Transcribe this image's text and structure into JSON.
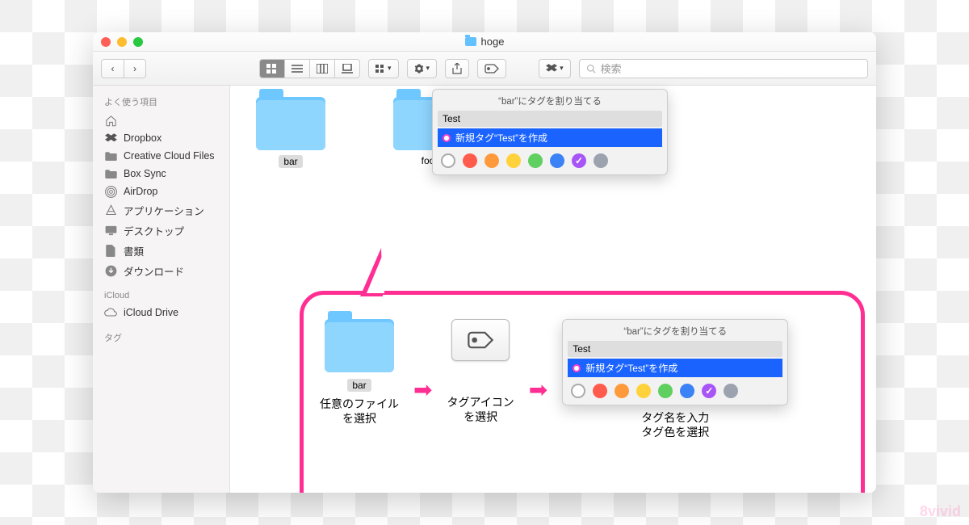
{
  "window": {
    "title": "hoge"
  },
  "toolbar": {
    "search_placeholder": "検索"
  },
  "sidebar": {
    "favorites_header": "よく使う項目",
    "items": [
      {
        "label": "",
        "icon": "home-icon"
      },
      {
        "label": "Dropbox",
        "icon": "dropbox-icon"
      },
      {
        "label": "Creative Cloud Files",
        "icon": "folder-icon"
      },
      {
        "label": "Box Sync",
        "icon": "folder-icon"
      },
      {
        "label": "AirDrop",
        "icon": "airdrop-icon"
      },
      {
        "label": "アプリケーション",
        "icon": "apps-icon"
      },
      {
        "label": "デスクトップ",
        "icon": "desktop-icon"
      },
      {
        "label": "書類",
        "icon": "documents-icon"
      },
      {
        "label": "ダウンロード",
        "icon": "downloads-icon"
      }
    ],
    "icloud_header": "iCloud",
    "icloud_item": "iCloud Drive",
    "tags_header": "タグ"
  },
  "content": {
    "folders": [
      {
        "name": "bar",
        "selected": true
      },
      {
        "name": "foo",
        "selected": false
      }
    ]
  },
  "tag_popover": {
    "title": "“bar”にタグを割り当てる",
    "input_value": "Test",
    "create_label": "新規タグ“Test”を作成",
    "colors": [
      {
        "name": "none",
        "hex": "#ffffff",
        "selected": false
      },
      {
        "name": "red",
        "hex": "#ff5b4c",
        "selected": false
      },
      {
        "name": "orange",
        "hex": "#ff9a3c",
        "selected": false
      },
      {
        "name": "yellow",
        "hex": "#ffd23c",
        "selected": false
      },
      {
        "name": "green",
        "hex": "#5fcf5f",
        "selected": false
      },
      {
        "name": "blue",
        "hex": "#3b82f6",
        "selected": false
      },
      {
        "name": "purple",
        "hex": "#a855f7",
        "selected": true
      },
      {
        "name": "gray",
        "hex": "#9ca3af",
        "selected": false
      }
    ]
  },
  "callout": {
    "step1": "任意のファイル\nを選択",
    "step2": "タグアイコン\nを選択",
    "step3": "タグ名を入力\nタグ色を選択",
    "folder_label": "bar"
  },
  "watermark": "8vivid"
}
